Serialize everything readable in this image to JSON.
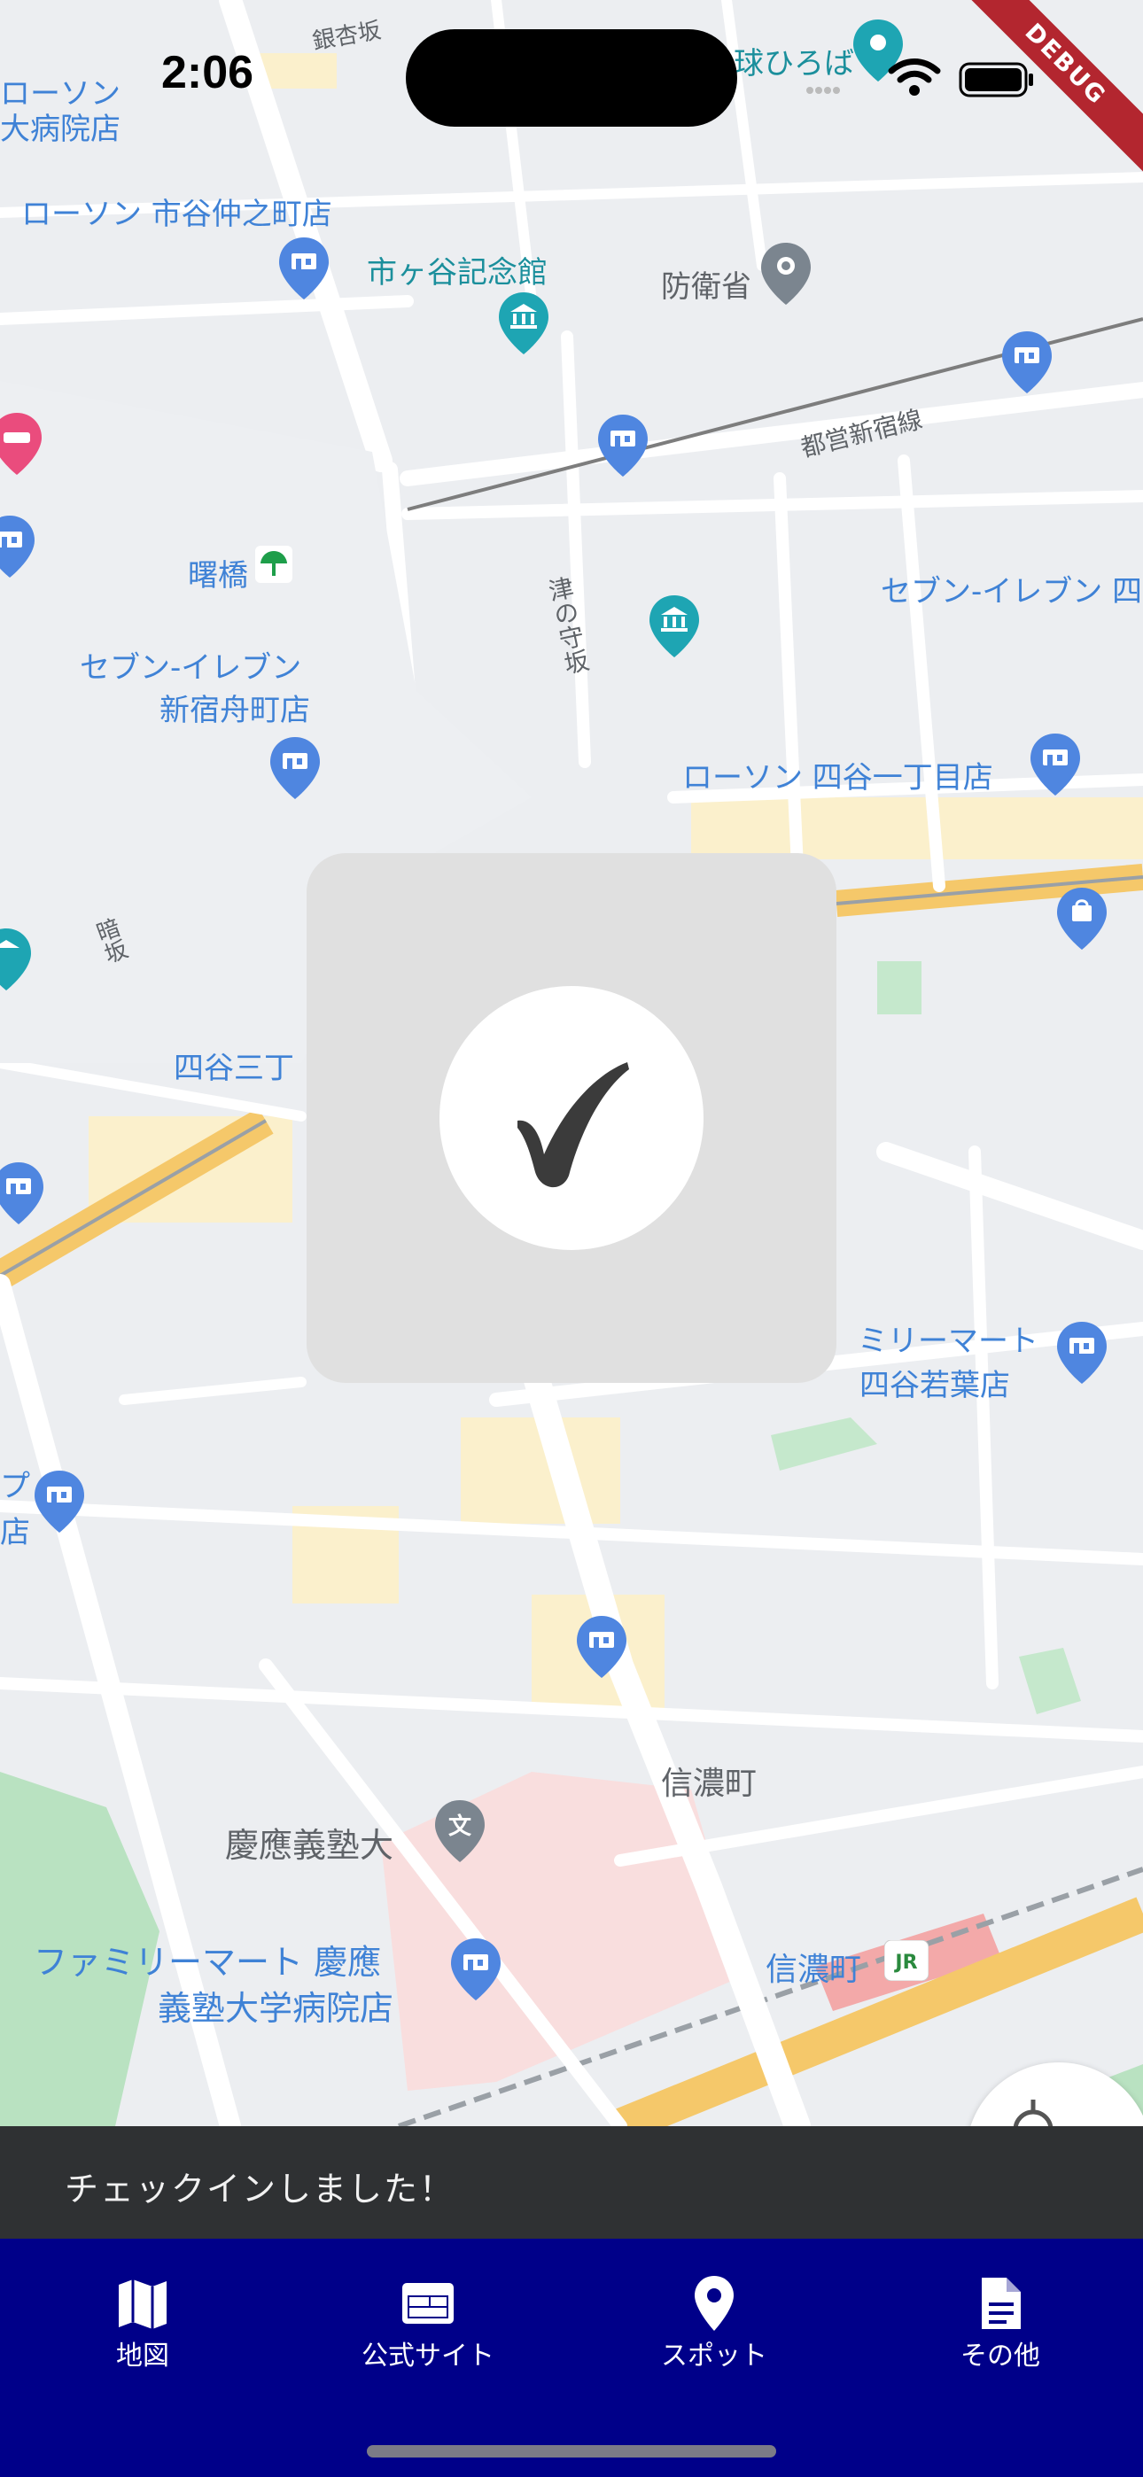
{
  "status_bar": {
    "time": "2:06"
  },
  "debug_banner": "DEBUG",
  "map": {
    "labels": {
      "ginkyo_zaka": "銀杏坂",
      "lawson_top": "ローソン",
      "hospital_top": "大病院店",
      "plaza": "球ひろば",
      "lawson_ichigaya": "ローソン 市谷仲之町店",
      "ichigaya_kinenkan": "市ヶ谷記念館",
      "boeisho": "防衛省",
      "toei_shinjuku": "都営新宿線",
      "akebonobashi": "曙橋",
      "seven_shinjuku_1": "セブン-イレブン",
      "seven_shinjuku_2": "新宿舟町店",
      "tsunokami_zaka": "津の守坂",
      "seven_right": "セブン-イレブン 四",
      "lawson_yotsuya": "ローソン 四谷一丁目店",
      "kurayami_zaka": "暗坂",
      "yotsuya_sanchome": "四谷三丁",
      "familymart_wakaba_1": "ミリーマート",
      "familymart_wakaba_2": "四谷若葉店",
      "left_cut_1": "プ",
      "left_cut_2": "店",
      "shinanomachi_area": "信濃町",
      "keio": "慶應義塾大",
      "familymart_keio_1": "ファミリーマート 慶應",
      "familymart_keio_2": "義塾大学病院店",
      "shinanomachi_station": "信濃町"
    }
  },
  "snackbar": {
    "message": "チェックインしました！"
  },
  "bottom_nav": {
    "items": [
      {
        "label": "地図",
        "icon": "map-icon"
      },
      {
        "label": "公式サイト",
        "icon": "web-icon"
      },
      {
        "label": "スポット",
        "icon": "location-pin-icon"
      },
      {
        "label": "その他",
        "icon": "document-icon"
      }
    ]
  },
  "colors": {
    "nav_background": "#000089",
    "snackbar_background": "#2f3133",
    "overlay_background": "#e0e0e0",
    "debug_ribbon": "#b3262f"
  }
}
